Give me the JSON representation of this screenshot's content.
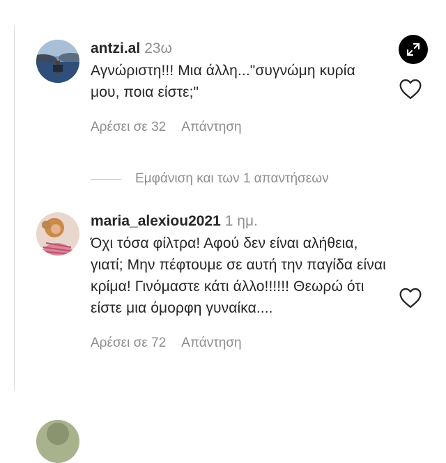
{
  "comments": [
    {
      "username": "antzi.al",
      "time": "23ω",
      "text": "Αγνώριστη!!! Μια άλλη...\"συγνώμη κυρία μου, ποια είστε;\"",
      "likes_label": "Αρέσει σε 32",
      "reply_label": "Απάντηση",
      "avatar_icon": "profile-photo-landscape"
    },
    {
      "username": "maria_alexiou2021",
      "time": "1 ημ.",
      "text": "Όχι τόσα φίλτρα! Αφού δεν είναι αλήθεια, γιατί; Μην πέφτουμε σε αυτή την παγίδα είναι κρίμα! Γινόμαστε κάτι άλλο!!!!!! Θεωρώ ότι είστε μια όμορφη γυναίκα....",
      "likes_label": "Αρέσει σε 72",
      "reply_label": "Απάντηση",
      "avatar_icon": "profile-photo-person"
    }
  ],
  "view_replies_label": "Εμφάνιση και των 1 απαντήσεων",
  "icons": {
    "heart": "heart-outline-icon",
    "expand": "expand-arrows-icon"
  },
  "colors": {
    "text": "#262626",
    "secondary": "#8e8e8e",
    "divider": "#dbdbdb",
    "expand_bg": "#000000"
  }
}
